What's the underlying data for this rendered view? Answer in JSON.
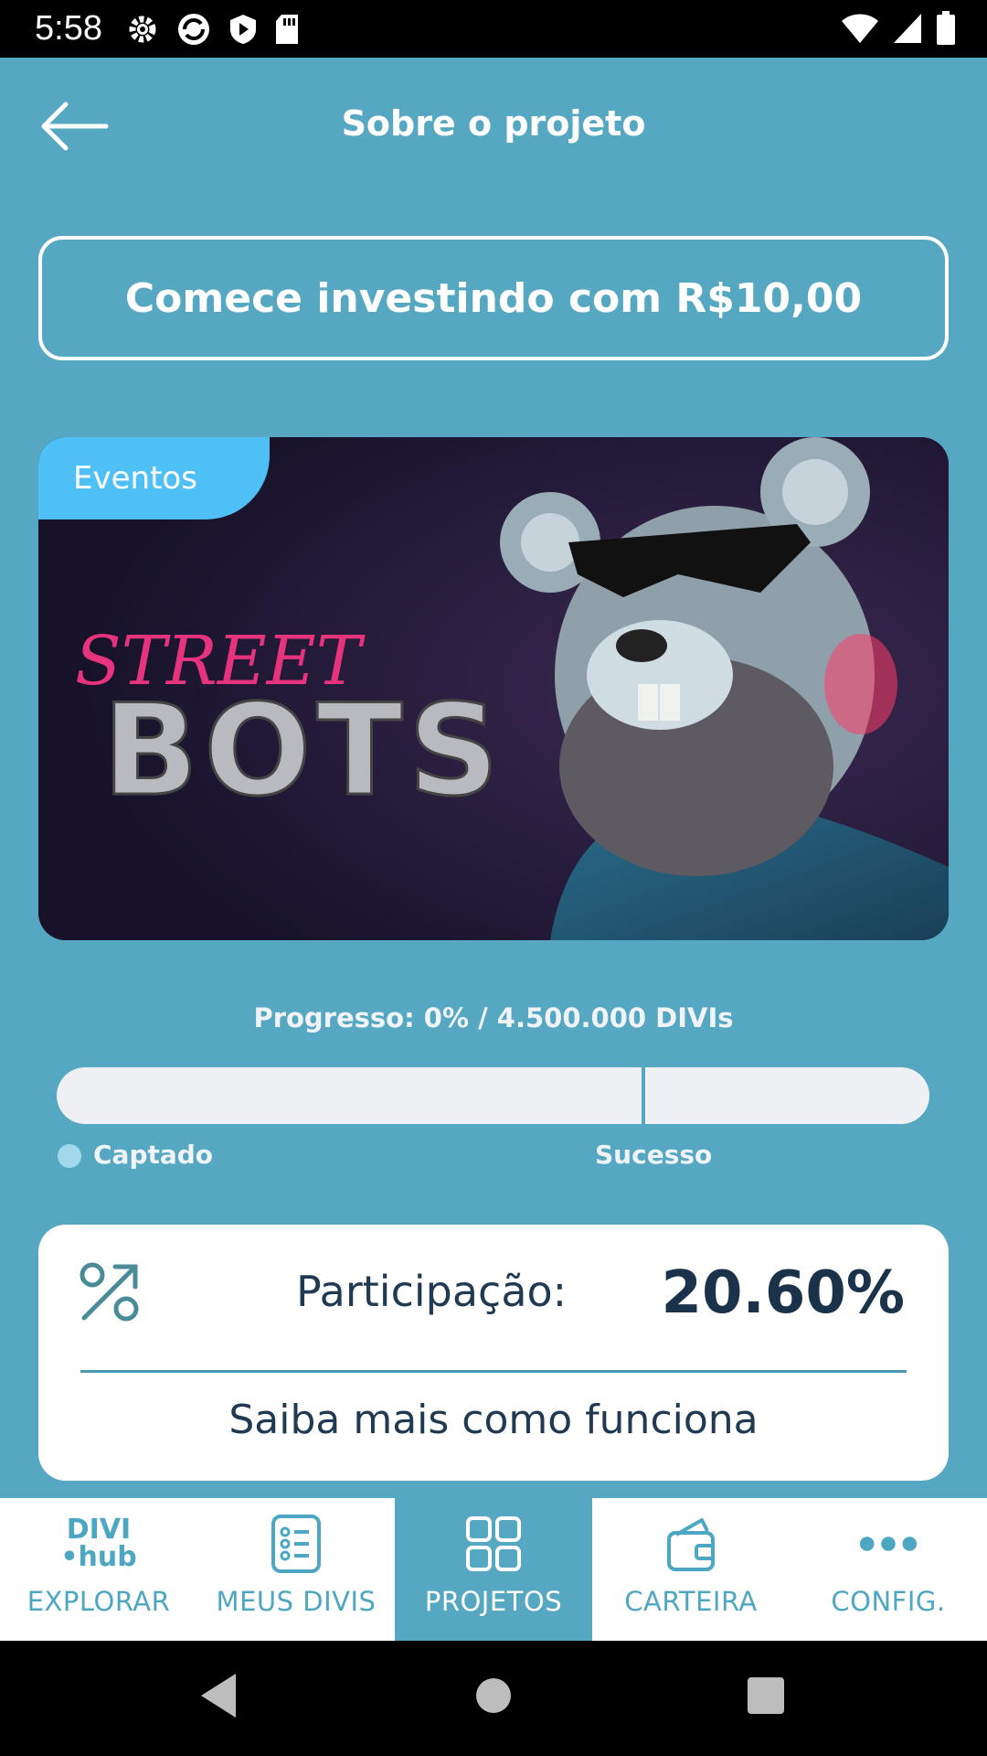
{
  "status_bar": {
    "time": "5:58"
  },
  "header": {
    "title": "Sobre o projeto"
  },
  "invest_button": {
    "label": "Comece investindo com R$10,00"
  },
  "banner": {
    "category": "Eventos",
    "art_text_top": "STREET",
    "art_text_bottom": "BOTS"
  },
  "progress": {
    "label": "Progresso: 0% / 4.500.000 DIVIs",
    "fraction": 0,
    "success_fraction": 0.67,
    "legend_raised": "Captado",
    "legend_success": "Sucesso"
  },
  "participation": {
    "label": "Participação:",
    "value": "20.60%",
    "learn_more": "Saiba mais como funciona"
  },
  "bottom_nav": {
    "logo_top": "DIVI",
    "logo_bottom": "•hub",
    "items": [
      {
        "label": "EXPLORAR",
        "icon": "divi-hub-logo"
      },
      {
        "label": "MEUS DIVIS",
        "icon": "list-icon"
      },
      {
        "label": "PROJETOS",
        "icon": "grid-icon"
      },
      {
        "label": "CARTEIRA",
        "icon": "wallet-icon"
      },
      {
        "label": "CONFIG.",
        "icon": "more-icon"
      }
    ],
    "active_index": 2
  },
  "colors": {
    "background": "#56a8c2",
    "tag": "#4fc0f5",
    "card_text": "#1f3a52",
    "nav_accent": "#4ea7c2"
  }
}
